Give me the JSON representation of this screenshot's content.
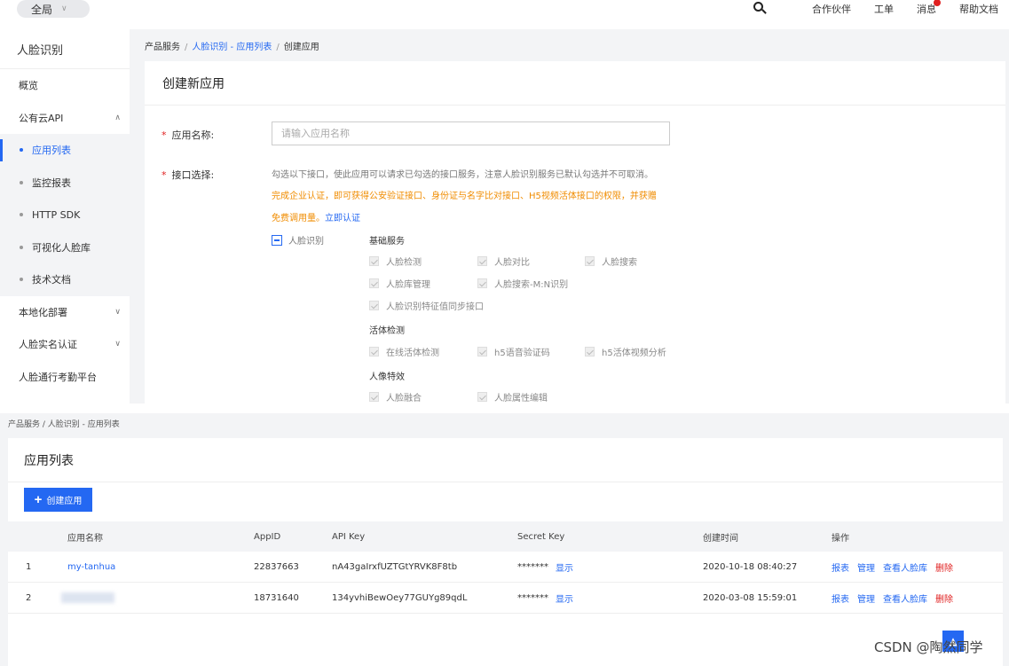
{
  "topbar": {
    "scope_label": "全局",
    "nav": [
      "合作伙伴",
      "工单",
      "消息",
      "帮助文档"
    ]
  },
  "sidebar": {
    "title": "人脸识别",
    "overview": "概览",
    "public_api": "公有云API",
    "sub_items": [
      "应用列表",
      "监控报表",
      "HTTP SDK",
      "可视化人脸库",
      "技术文档"
    ],
    "local_deploy": "本地化部署",
    "realname": "人脸实名认证",
    "attendance": "人脸通行考勤平台"
  },
  "breadcrumb1": {
    "root": "产品服务",
    "link": "人脸识别 - 应用列表",
    "current": "创建应用"
  },
  "create_form": {
    "heading": "创建新应用",
    "name_label": "应用名称:",
    "name_placeholder": "请输入应用名称",
    "api_label": "接口选择:",
    "desc_gray": "勾选以下接口，使此应用可以请求已勾选的接口服务，注意人脸识别服务已默认勾选并不可取消。",
    "desc_orange_1": "完成企业认证，即可获得公安验证接口、身份证与名字比对接口、H5视频活体接口的权限，并获赠",
    "desc_orange_2": "免费调用量。",
    "desc_link": "立即认证",
    "group_label": "人脸识别",
    "categories": [
      {
        "title": "基础服务",
        "items": [
          "人脸检测",
          "人脸对比",
          "人脸搜索",
          "人脸库管理",
          "人脸搜索-M:N识别",
          "人脸识别特征值同步接口"
        ]
      },
      {
        "title": "活体检测",
        "items": [
          "在线活体检测",
          "h5语音验证码",
          "h5活体视频分析"
        ]
      },
      {
        "title": "人像特效",
        "items": [
          "人脸融合",
          "人脸属性编辑"
        ]
      }
    ]
  },
  "breadcrumb2": "产品服务 / 人脸识别 - 应用列表",
  "app_list": {
    "title": "应用列表",
    "create_button": "创建应用",
    "columns": [
      "应用名称",
      "AppID",
      "API Key",
      "Secret Key",
      "创建时间",
      "操作"
    ],
    "rows": [
      {
        "index": "1",
        "name": "my-tanhua",
        "appid": "22837663",
        "api_key": "nA43gaIrxfUZTGtYRVK8F8tb",
        "secret": "*******",
        "show": "显示",
        "created": "2020-10-18 08:40:27"
      },
      {
        "index": "2",
        "name": "",
        "appid": "18731640",
        "api_key": "134yvhiBewOey77GUYg89qdL",
        "secret": "*******",
        "show": "显示",
        "created": "2020-03-08 15:59:01"
      }
    ],
    "ops": [
      "报表",
      "管理",
      "查看人脸库",
      "删除"
    ]
  },
  "watermark": "CSDN @陶然同学",
  "colors": {
    "accent": "#2468f2",
    "warning": "#f08c00",
    "danger": "#e02020"
  }
}
